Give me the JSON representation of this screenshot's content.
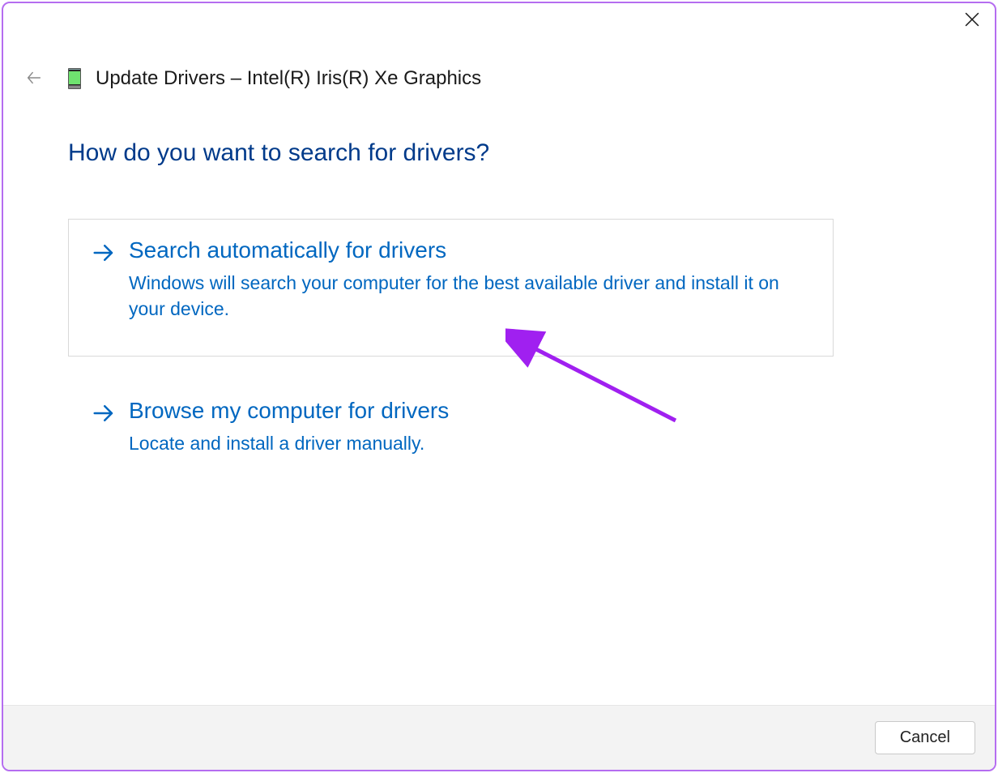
{
  "window": {
    "title": "Update Drivers – Intel(R) Iris(R) Xe Graphics"
  },
  "heading": "How do you want to search for drivers?",
  "options": [
    {
      "title": "Search automatically for drivers",
      "description": "Windows will search your computer for the best available driver and install it on your device."
    },
    {
      "title": "Browse my computer for drivers",
      "description": "Locate and install a driver manually."
    }
  ],
  "buttons": {
    "cancel": "Cancel"
  }
}
